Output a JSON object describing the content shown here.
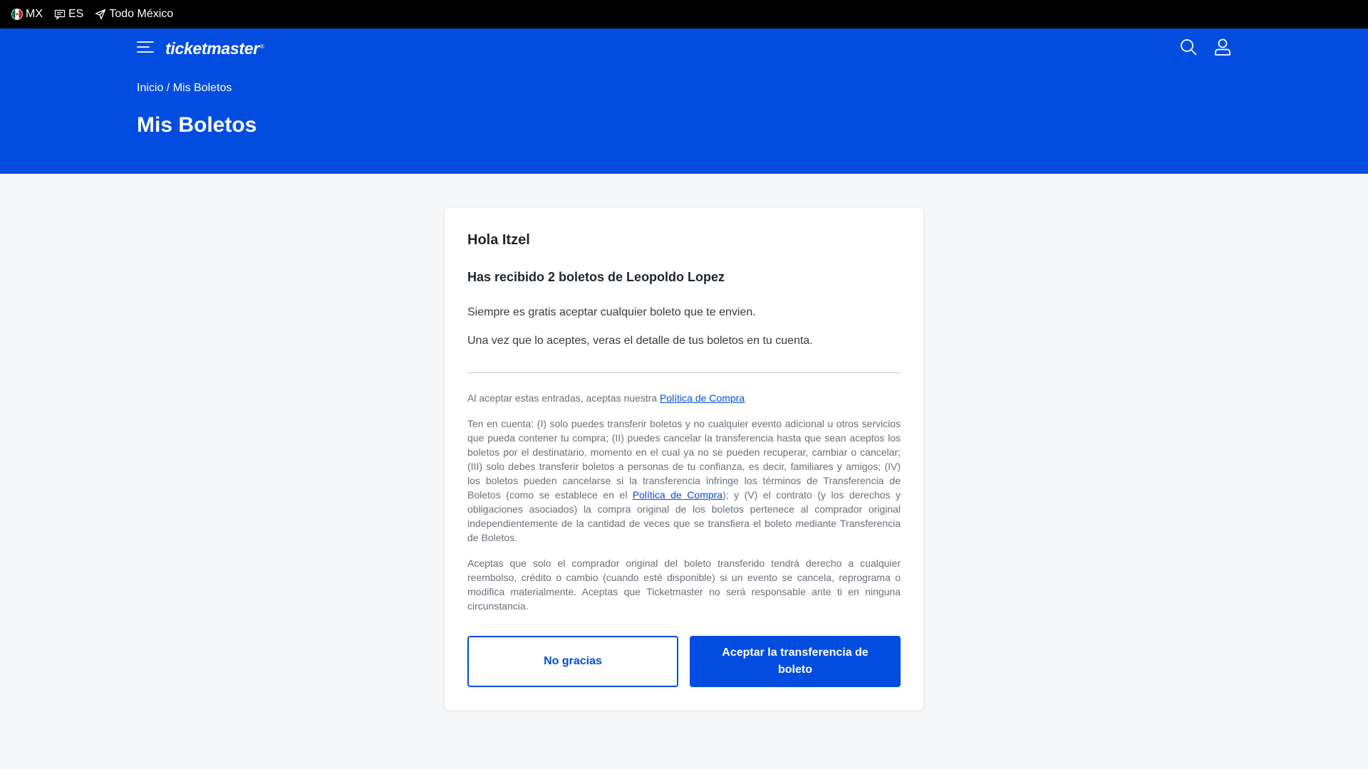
{
  "topbar": {
    "country": "MX",
    "language": "ES",
    "location": "Todo México"
  },
  "header": {
    "logo": "ticketmaster",
    "logo_mark": "®",
    "breadcrumb_home": "Inicio",
    "breadcrumb_sep": " / ",
    "breadcrumb_current": "Mis Boletos",
    "title": "Mis Boletos"
  },
  "card": {
    "greeting": "Hola Itzel",
    "received": "Has recibido 2 boletos de Leopoldo Lopez",
    "para1": "Siempre es gratis aceptar cualquier boleto que te envien.",
    "para2": "Una vez que lo aceptes, veras el detalle de tus boletos en tu cuenta.",
    "terms_intro": "Al aceptar estas entradas, aceptas nuestra ",
    "policy_link": "Política de Compra",
    "terms_part1": "Ten en cuenta: (I) solo puedes transferir boletos y no cualquier evento adicional u otros servicios que pueda contener tu compra; (II) puedes cancelar la transferencia hasta que sean aceptos los boletos por el destinatario, momento en el cual ya no se pueden recuperar, cambiar o cancelar; (III) solo debes transferir boletos a personas de tu confianza, es decir, familiares y amigos; (IV) los boletos pueden cancelarse si la transferencia infringe los términos de Transferencia de Boletos (como se establece en el ",
    "terms_part2": "); y (V) el contrato (y los derechos y obligaciones asociados) la compra original de los boletos pertenece al comprador original independientemente de la cantidad de veces que se transfiera el boleto mediante Transferencia de Boletos.",
    "terms_para3": "Aceptas que solo el comprador original del boleto transferido tendrá derecho a cualquier reembolso, crédito o cambio (cuando esté disponible) si un evento se cancela, reprograma o modifica materialmente. Aceptas que Ticketmaster no será responsable ante ti en ninguna circunstancia.",
    "decline_label": "No gracias",
    "accept_label": "Aceptar la transferencia de boleto"
  },
  "colors": {
    "brand": "#024ddf",
    "topbar": "#000000",
    "background": "#f6f7f9"
  },
  "icons": [
    "mexico-flag-icon",
    "chat-icon",
    "location-arrow-icon",
    "menu-icon",
    "search-icon",
    "user-icon"
  ]
}
